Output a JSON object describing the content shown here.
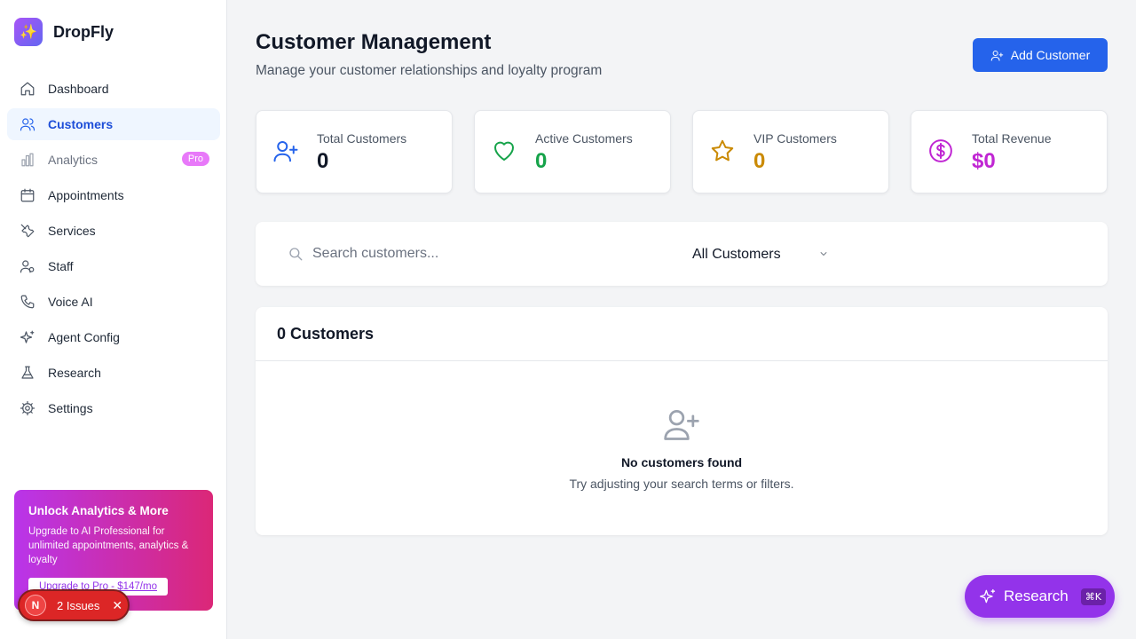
{
  "app": {
    "name": "DropFly"
  },
  "sidebar": {
    "items": [
      {
        "label": "Dashboard",
        "icon": "home-icon"
      },
      {
        "label": "Customers",
        "icon": "users-icon",
        "active": true
      },
      {
        "label": "Analytics",
        "icon": "bar-chart-icon",
        "badge": "Pro"
      },
      {
        "label": "Appointments",
        "icon": "calendar-icon"
      },
      {
        "label": "Services",
        "icon": "tools-icon"
      },
      {
        "label": "Staff",
        "icon": "staff-icon"
      },
      {
        "label": "Voice AI",
        "icon": "phone-icon"
      },
      {
        "label": "Agent Config",
        "icon": "sparkles-icon"
      },
      {
        "label": "Research",
        "icon": "flask-icon"
      },
      {
        "label": "Settings",
        "icon": "gear-icon"
      }
    ],
    "promo": {
      "title": "Unlock Analytics & More",
      "text": "Upgrade to AI Professional for unlimited appointments, analytics & loyalty",
      "button": "Upgrade to Pro - $147/mo"
    }
  },
  "issues": {
    "logo": "N",
    "label": "2 Issues",
    "close": "✕"
  },
  "header": {
    "title": "Customer Management",
    "subtitle": "Manage your customer relationships and loyalty program",
    "add_button": "Add Customer"
  },
  "stats": [
    {
      "label": "Total Customers",
      "value": "0",
      "color": "#111827",
      "icon": "user-plus-icon"
    },
    {
      "label": "Active Customers",
      "value": "0",
      "color": "#16a34a",
      "icon": "heart-icon"
    },
    {
      "label": "VIP Customers",
      "value": "0",
      "color": "#ca8a04",
      "icon": "star-icon"
    },
    {
      "label": "Total Revenue",
      "value": "$0",
      "color": "#c026d3",
      "icon": "dollar-icon"
    }
  ],
  "filters": {
    "search_placeholder": "Search customers...",
    "search_value": "",
    "select_value": "All Customers"
  },
  "list": {
    "count_label": "0 Customers",
    "empty_title": "No customers found",
    "empty_subtitle": "Try adjusting your search terms or filters."
  },
  "research_button": {
    "label": "Research",
    "shortcut": "⌘K"
  },
  "colors": {
    "accent": "#2563eb",
    "brand": "#9333ea",
    "danger": "#dc2626"
  }
}
